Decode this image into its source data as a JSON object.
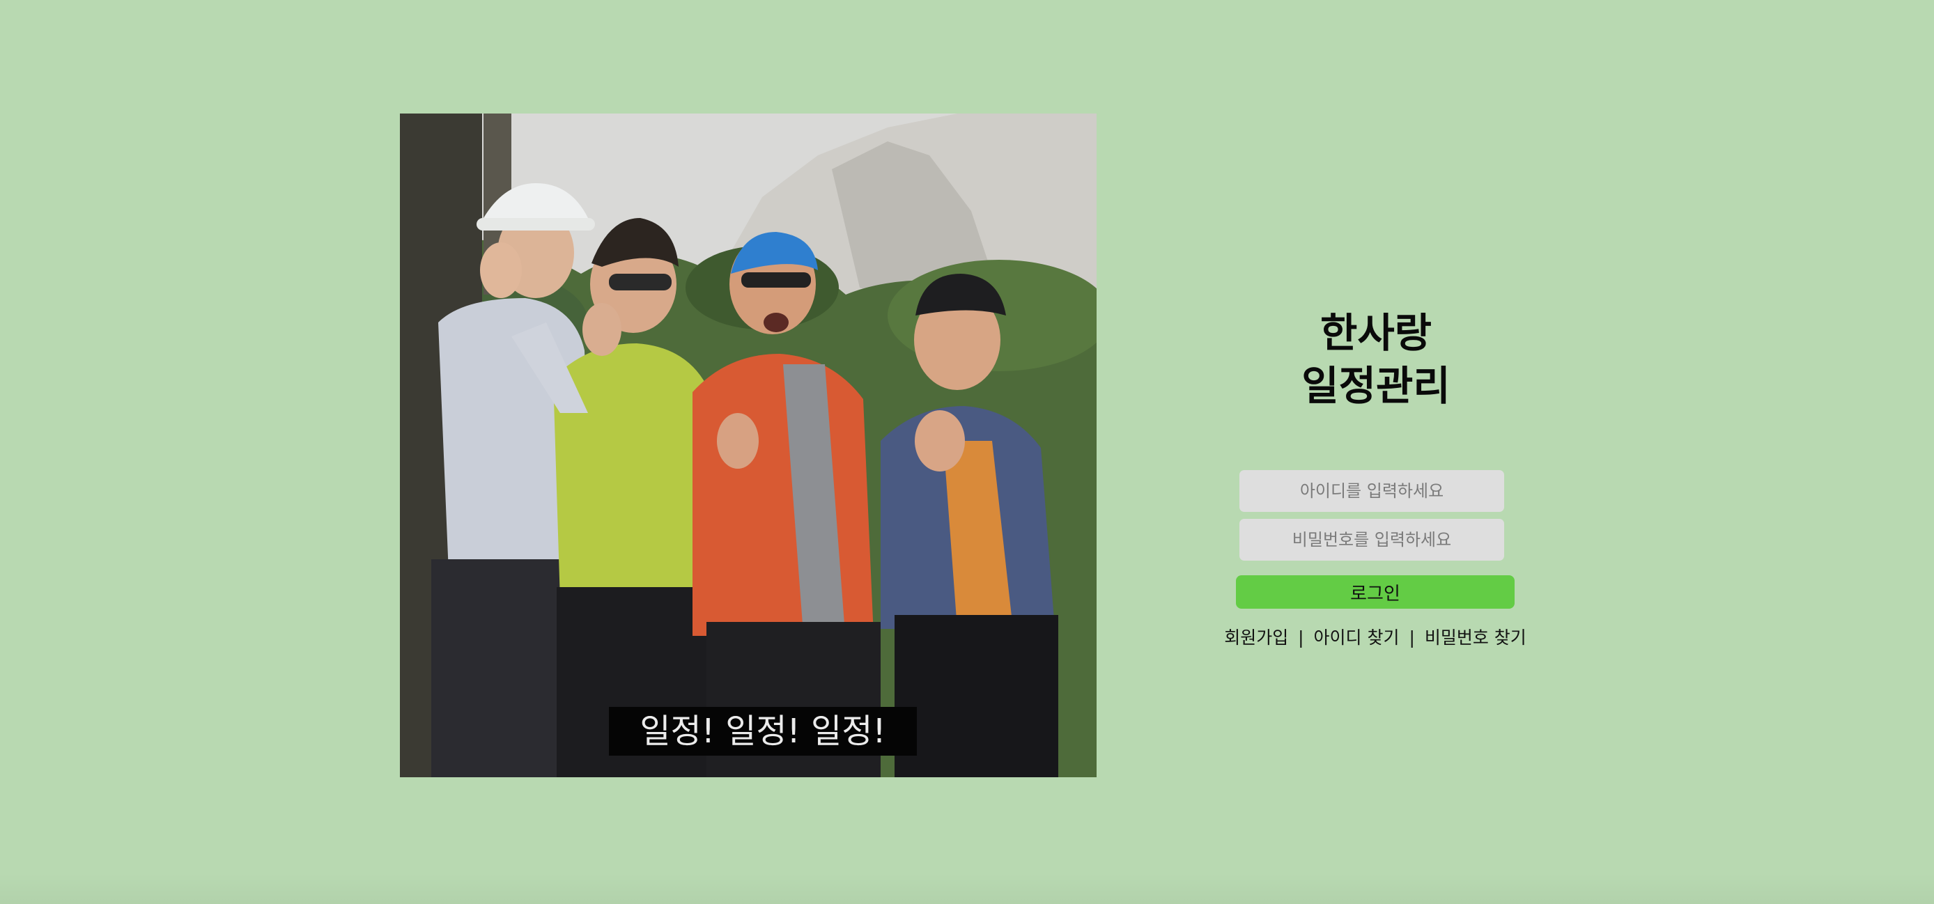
{
  "photo": {
    "caption": "일정! 일정! 일정!"
  },
  "app": {
    "title_line1": "한사랑",
    "title_line2": "일정관리"
  },
  "login": {
    "id_placeholder": "아이디를 입력하세요",
    "pw_placeholder": "비밀번호를 입력하세요",
    "submit_label": "로그인"
  },
  "links": {
    "signup": "회원가입",
    "find_id": "아이디 찾기",
    "find_pw": "비밀번호 찾기",
    "separator": "|"
  },
  "colors": {
    "page_background": "#b8d9b1",
    "login_button": "#63cc45",
    "input_background": "#dedede"
  }
}
